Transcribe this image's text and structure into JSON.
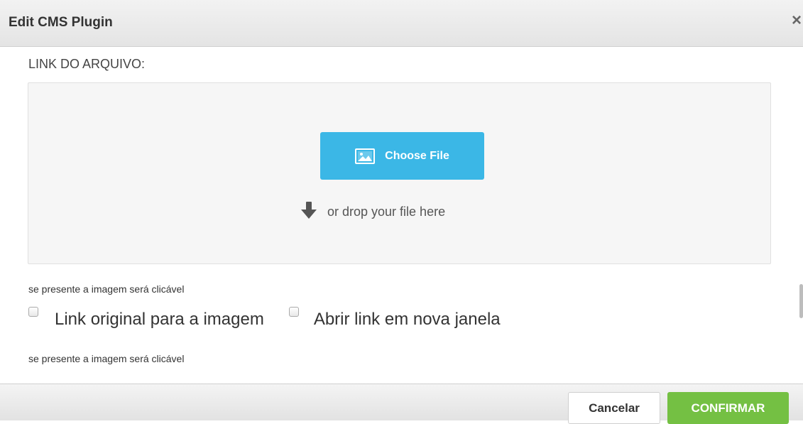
{
  "dialog": {
    "title": "Edit CMS Plugin",
    "close_glyph": "×"
  },
  "form": {
    "field_label": "LINK DO ARQUIVO:",
    "dropzone": {
      "choose_label": "Choose File",
      "choose_icon": "image-icon",
      "drop_icon": "arrow-down-icon",
      "drop_text": "or drop your file here"
    },
    "help_text_1": "se presente a imagem será clicável",
    "checkboxes": [
      {
        "label": "Link original para a imagem",
        "checked": false
      },
      {
        "label": "Abrir link em nova janela",
        "checked": false
      }
    ],
    "help_text_2": "se presente a imagem será clicável"
  },
  "footer": {
    "cancel_label": "Cancelar",
    "confirm_label": "CONFIRMAR"
  },
  "colors": {
    "choose_button": "#3bb7e6",
    "confirm_button": "#74c043",
    "dropzone_bg": "#f6f6f6"
  }
}
